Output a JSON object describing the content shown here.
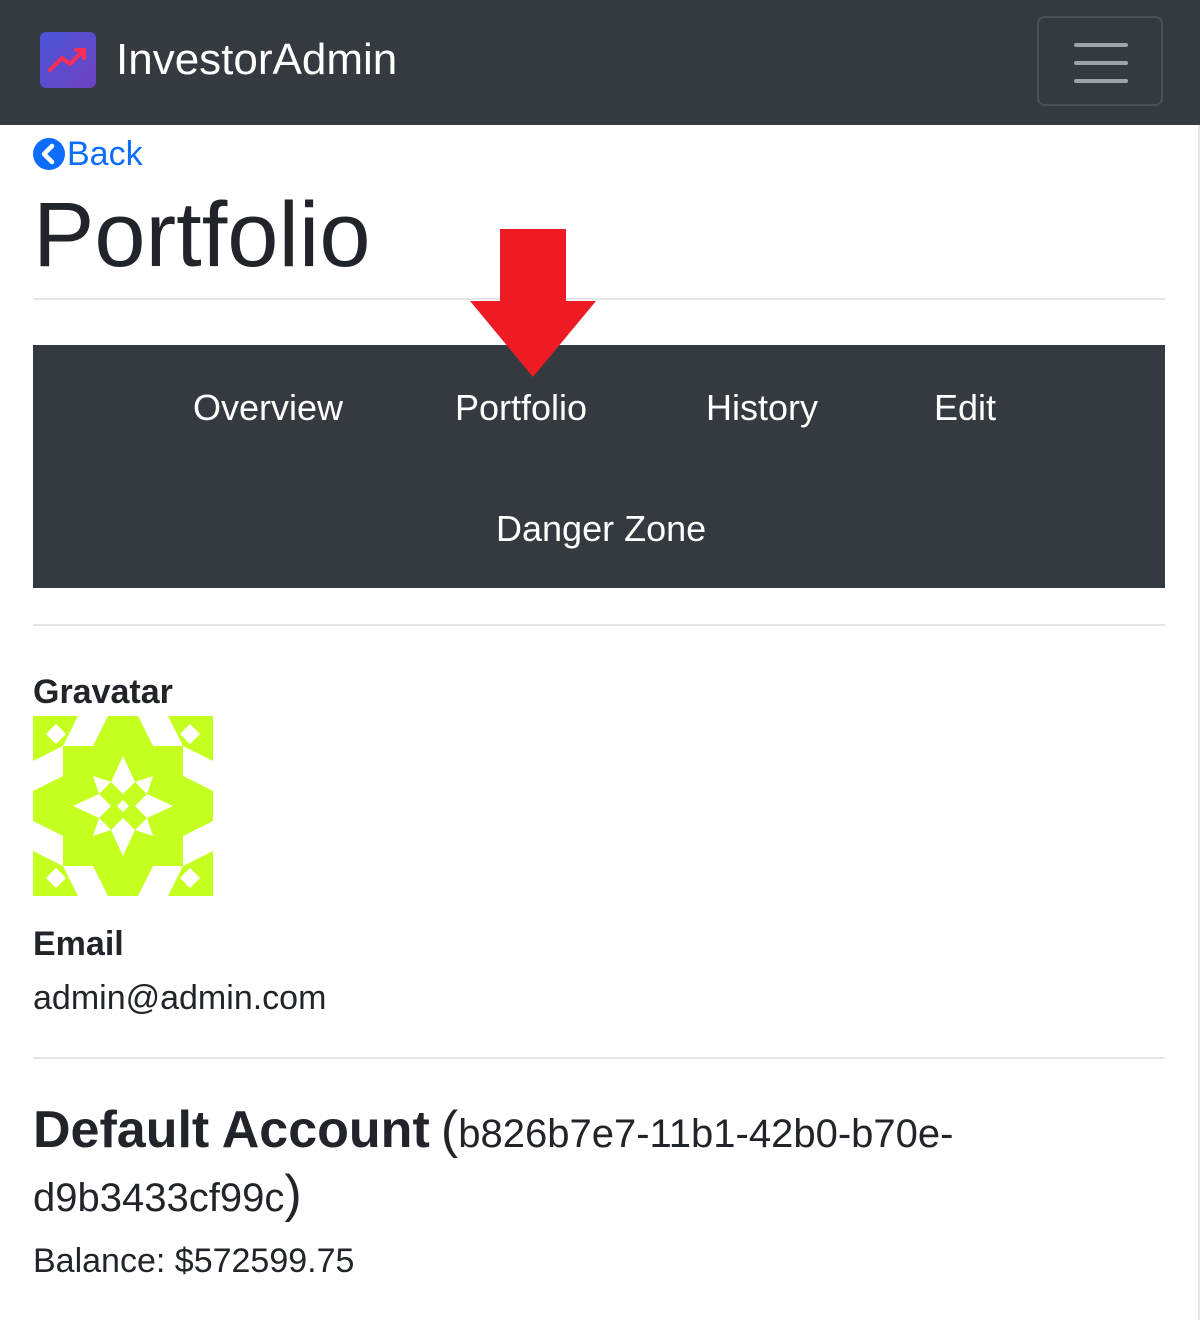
{
  "navbar": {
    "brand_name": "InvestorAdmin",
    "logo_icon": "trending-up-icon",
    "menu_icon": "hamburger-menu-icon"
  },
  "back": {
    "label": "Back",
    "icon": "chevron-left-circle-icon"
  },
  "page_title": "Portfolio",
  "tabs": [
    {
      "label": "Overview"
    },
    {
      "label": "Portfolio"
    },
    {
      "label": "History"
    },
    {
      "label": "Edit"
    },
    {
      "label": "Danger Zone"
    }
  ],
  "annotation": {
    "icon": "red-down-arrow-icon",
    "color": "#ed1c24"
  },
  "profile": {
    "gravatar_label": "Gravatar",
    "gravatar_color": "#c4ff1f",
    "email_label": "Email",
    "email_value": "admin@admin.com"
  },
  "account": {
    "name": "Default Account",
    "open_paren": "(",
    "id": "b826b7e7-11b1-42b0-b70e-d9b3433cf99c",
    "close_paren": ")",
    "balance_label": "Balance:",
    "balance_value": "$572599.75"
  },
  "colors": {
    "navbar_bg": "#343a40",
    "link": "#0d6efd",
    "text": "#212529"
  }
}
